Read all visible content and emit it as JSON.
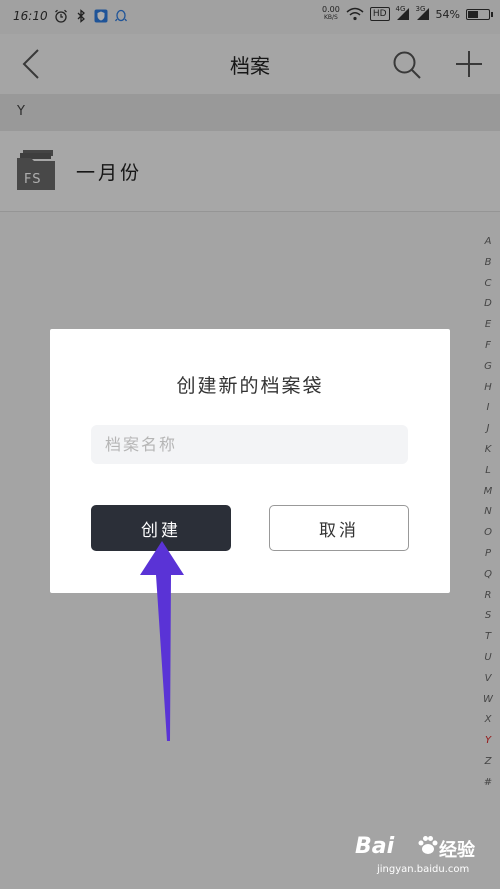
{
  "status_bar": {
    "time": "16:10",
    "net_speed_value": "0.00",
    "net_speed_unit": "KB/S",
    "hd_badge": "HD",
    "signal1_label": "4G",
    "signal2_label": "3G",
    "battery_text": "54%",
    "battery_level_percent": 54
  },
  "nav": {
    "title": "档案"
  },
  "section": {
    "letter": "Y"
  },
  "list": {
    "items": [
      {
        "icon_text": "FS",
        "label": "一月份"
      }
    ]
  },
  "alpha_index": {
    "letters": [
      "A",
      "B",
      "C",
      "D",
      "E",
      "F",
      "G",
      "H",
      "I",
      "J",
      "K",
      "L",
      "M",
      "N",
      "O",
      "P",
      "Q",
      "R",
      "S",
      "T",
      "U",
      "V",
      "W",
      "X",
      "Y",
      "Z",
      "#"
    ],
    "active": "Y"
  },
  "dialog": {
    "title": "创建新的档案袋",
    "input_value": "",
    "input_placeholder": "档案名称",
    "create_label": "创建",
    "cancel_label": "取消"
  },
  "watermark": {
    "brand": "Bai",
    "sub": "经验",
    "url": "jingyan.baidu.com"
  },
  "colors": {
    "dialog_primary": "#2b2f38",
    "annotation_arrow": "#5a33d6",
    "index_active": "#d22222"
  }
}
